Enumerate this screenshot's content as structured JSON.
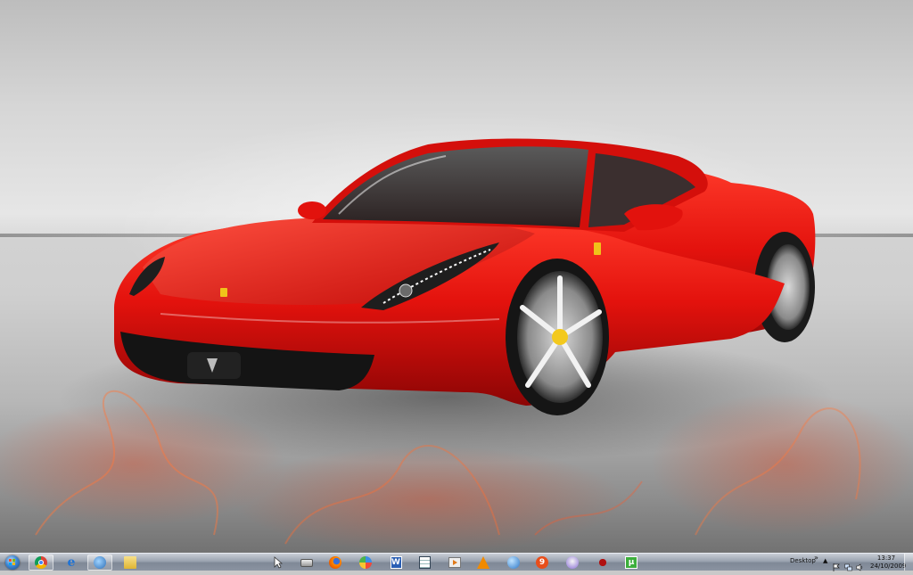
{
  "desktop": {
    "wallpaper": "red sports car wallpaper",
    "colors": {
      "car_red": "#e01010",
      "car_dark_red": "#8a0606",
      "floor": "#b7b7b7"
    }
  },
  "taskbar": {
    "pinned_apps": [
      {
        "name": "Google Chrome",
        "icon": "chrome-icon"
      },
      {
        "name": "Internet Explorer",
        "icon": "ie-icon"
      },
      {
        "name": "Mozilla Thunderbird",
        "icon": "thunderbird-icon"
      },
      {
        "name": "Windows Explorer",
        "icon": "folder-icon"
      }
    ],
    "quick_launch": [
      {
        "icon": "cursor-icon"
      },
      {
        "icon": "drive-icon"
      },
      {
        "icon": "firefox-icon"
      },
      {
        "icon": "network-icon"
      },
      {
        "icon": "word-icon"
      },
      {
        "icon": "spreadsheet-icon"
      },
      {
        "icon": "media-player-icon"
      },
      {
        "icon": "vlc-icon"
      },
      {
        "icon": "globe-icon"
      },
      {
        "icon": "app-9-icon"
      },
      {
        "icon": "winamp-icon"
      },
      {
        "icon": "dragon-icon"
      },
      {
        "icon": "utorrent-icon"
      }
    ],
    "tray": {
      "desktop_label": "Desktop",
      "overflow_glyph": "»",
      "show_hidden_glyph": "▲",
      "clock": {
        "time": "13:37",
        "date": "24/10/2009"
      }
    }
  }
}
